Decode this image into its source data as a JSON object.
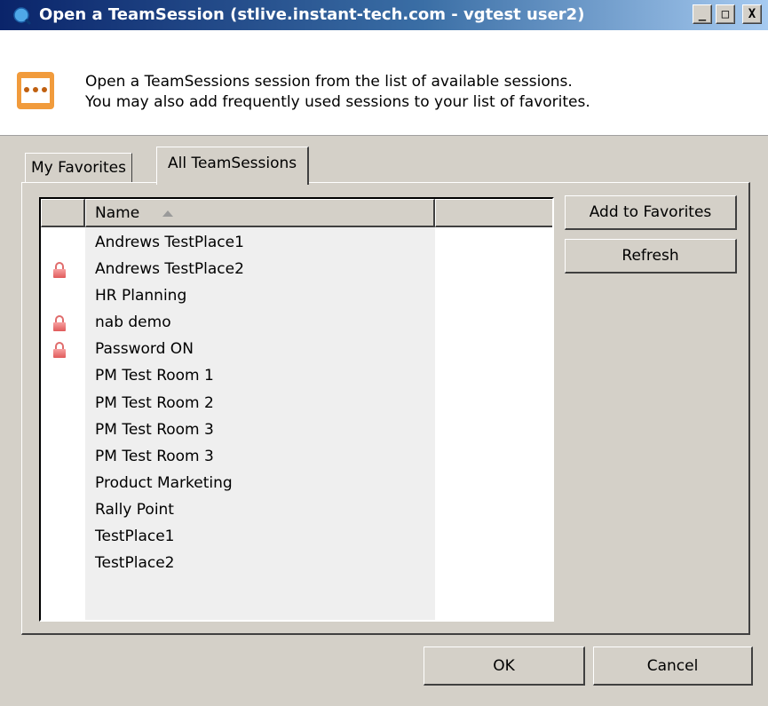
{
  "window": {
    "title": "Open a TeamSession (stlive.instant-tech.com - vgtest user2)",
    "buttons": [
      "_",
      "□",
      "X"
    ]
  },
  "header": {
    "line1": "Open a TeamSessions session from the list of available sessions.",
    "line2": "You may also add frequently used sessions to your list of favorites."
  },
  "tabs": [
    {
      "label": "My Favorites",
      "selected": false
    },
    {
      "label": "All TeamSessions",
      "selected": true
    }
  ],
  "list": {
    "columns": [
      "",
      "Name",
      ""
    ],
    "sort_indicator": "sort-ascending-icon",
    "rows": [
      {
        "name": "Andrews TestPlace1",
        "locked": false
      },
      {
        "name": "Andrews TestPlace2",
        "locked": true
      },
      {
        "name": "HR Planning",
        "locked": false
      },
      {
        "name": "nab demo",
        "locked": true
      },
      {
        "name": "Password ON",
        "locked": true
      },
      {
        "name": "PM Test Room 1",
        "locked": false
      },
      {
        "name": "PM Test Room 2",
        "locked": false
      },
      {
        "name": "PM Test Room 3",
        "locked": false
      },
      {
        "name": "PM Test Room 3",
        "locked": false
      },
      {
        "name": "Product Marketing",
        "locked": false
      },
      {
        "name": "Rally Point",
        "locked": false
      },
      {
        "name": "TestPlace1",
        "locked": false
      },
      {
        "name": "TestPlace2",
        "locked": false
      }
    ]
  },
  "side_buttons": {
    "add_favorites": "Add to Favorites",
    "refresh": "Refresh"
  },
  "footer": {
    "ok": "OK",
    "cancel": "Cancel"
  },
  "colors": {
    "title_gradient_start": "#0a246a",
    "title_gradient_end": "#a6caf0",
    "dialog_bg": "#d4d0c8",
    "lock": "#e05a5a",
    "header_icon": "#f19b3c"
  }
}
